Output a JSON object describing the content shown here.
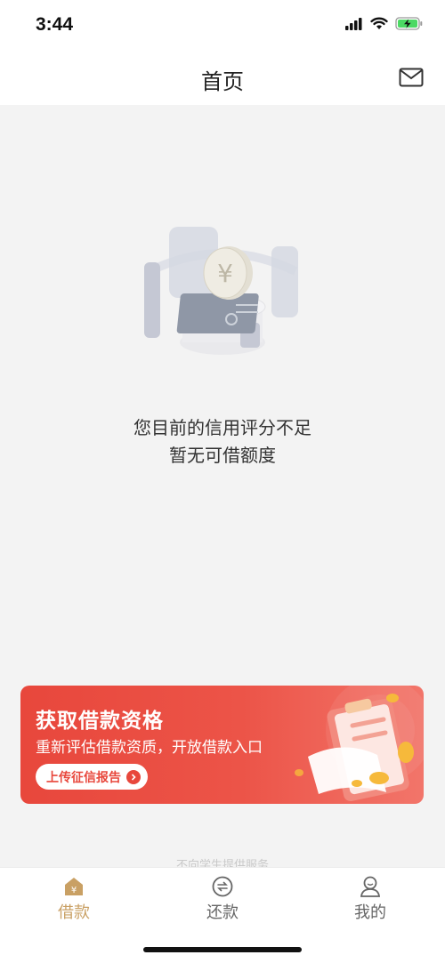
{
  "status_bar": {
    "time": "3:44"
  },
  "nav": {
    "title": "首页"
  },
  "empty_state": {
    "line1": "您目前的信用评分不足",
    "line2": "暂无可借额度"
  },
  "promo": {
    "title": "获取借款资格",
    "subtitle": "重新评估借款资质，开放借款入口",
    "button_label": "上传征信报告"
  },
  "footer_note": "不向学生提供服务",
  "tabs": [
    {
      "label": "借款",
      "icon": "house-yuan-icon",
      "active": true
    },
    {
      "label": "还款",
      "icon": "repay-icon",
      "active": false
    },
    {
      "label": "我的",
      "icon": "user-icon",
      "active": false
    }
  ],
  "colors": {
    "accent": "#c9a064",
    "promo_red": "#e8473c",
    "background": "#f3f3f3"
  }
}
